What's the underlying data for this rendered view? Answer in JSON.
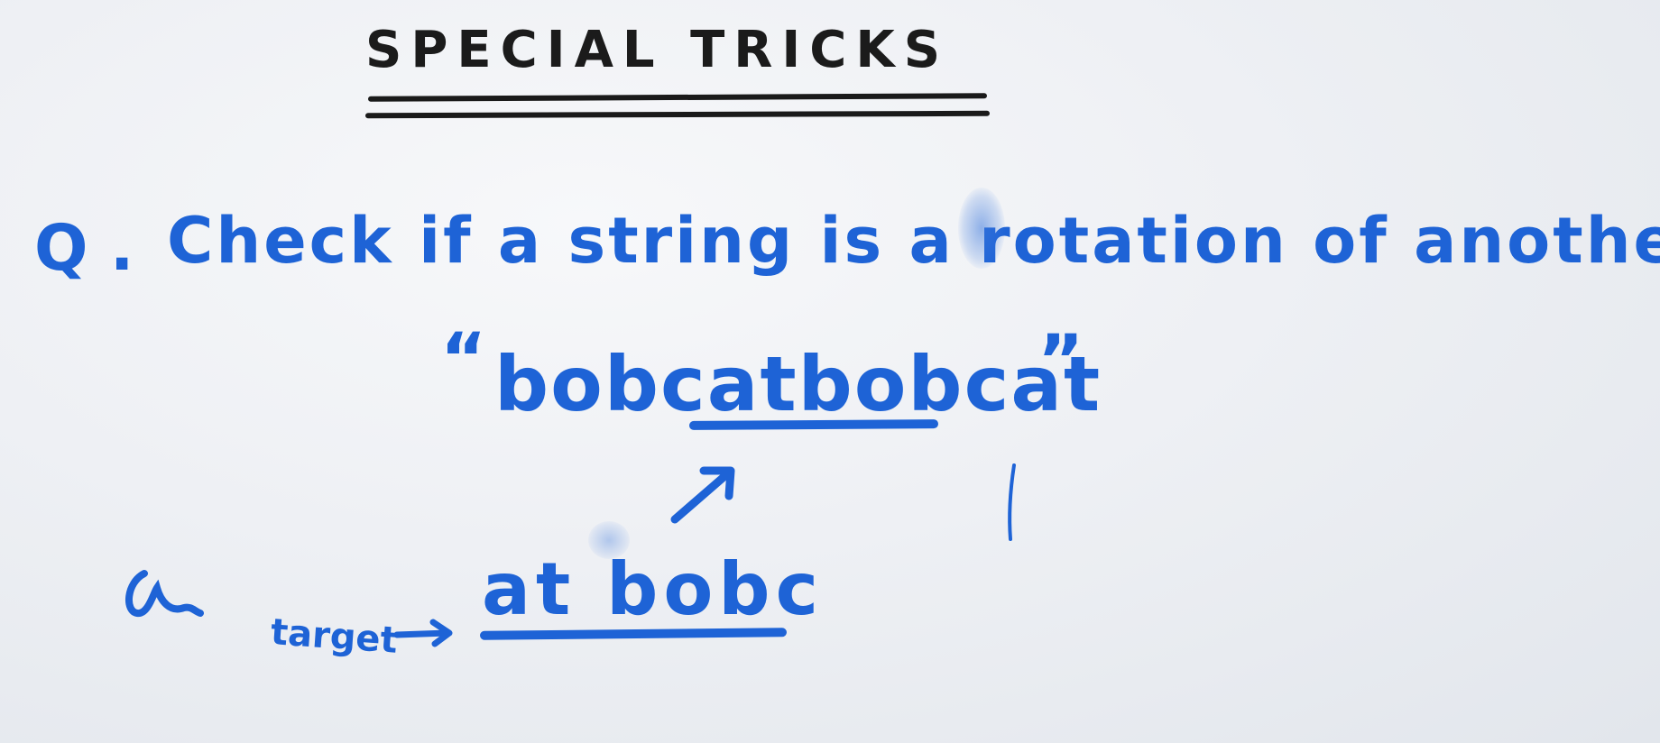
{
  "board": {
    "title": "SPECIAL TRICKS",
    "question_label": "Q .",
    "question_text": "Check if a string is a rotation of another",
    "open_quote": "“",
    "doubled_string": "bobcatbobcat",
    "close_quote": "”",
    "target_label": "target",
    "target_value": "at bobc"
  },
  "colors": {
    "ink_black": "#1b1b1b",
    "ink_blue": "#1e63d6",
    "board": "#eef0f4"
  },
  "icons": {
    "arrow": "arrow-up-right-icon",
    "target_arrow": "arrow-right-icon",
    "scribble": "scribble-icon",
    "mark": "stray-mark-icon"
  }
}
